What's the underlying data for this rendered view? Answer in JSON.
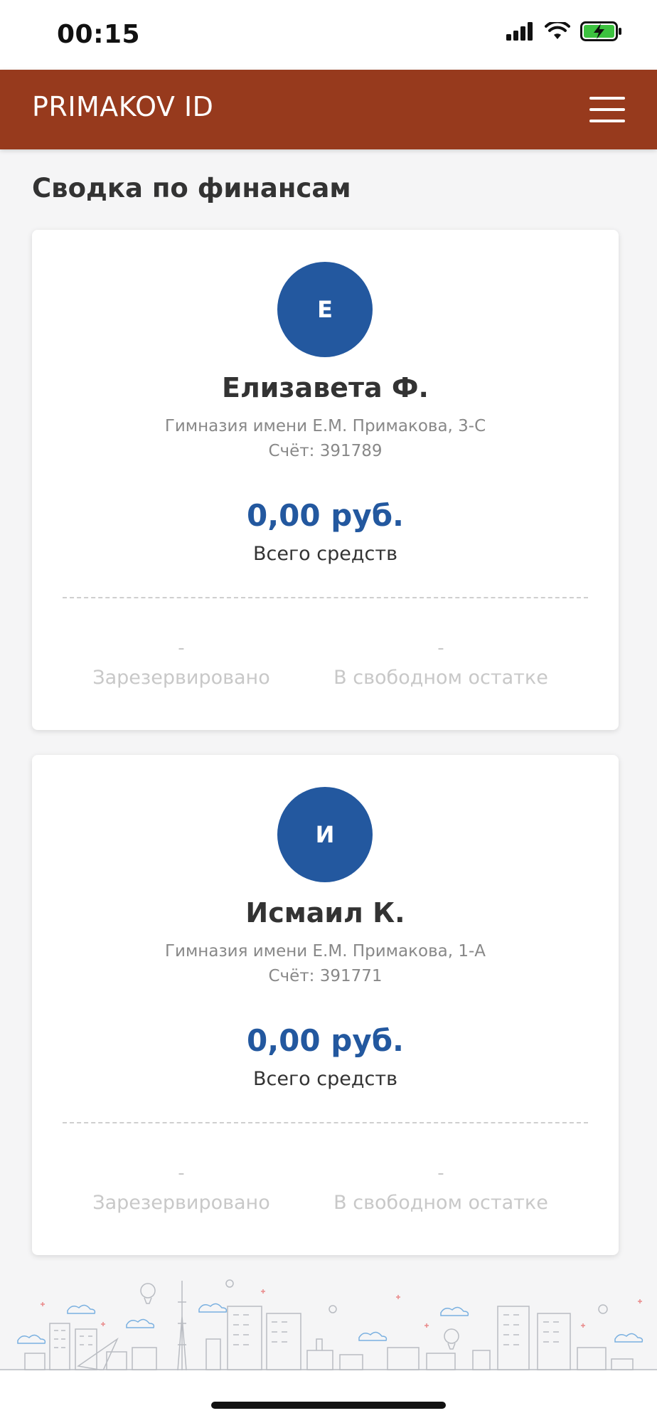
{
  "status": {
    "time": "00:15",
    "icons": [
      "signal-icon",
      "wifi-icon",
      "battery-charging-icon"
    ]
  },
  "header": {
    "title": "PRIMAKOV ID",
    "menu_icon": "hamburger-menu-icon"
  },
  "page": {
    "title": "Сводка по финансам"
  },
  "colors": {
    "header": "#973a1d",
    "accent": "#23589f"
  },
  "students": [
    {
      "initial": "Е",
      "name": "Елизавета Ф.",
      "school": "Гимназия имени Е.М. Примакова, 3-С",
      "account": "Счёт: 391789",
      "balance": "0,00 руб.",
      "balance_label": "Всего средств",
      "reserved_value": "-",
      "reserved_label": "Зарезервировано",
      "free_value": "-",
      "free_label": "В свободном остатке"
    },
    {
      "initial": "И",
      "name": "Исмаил К.",
      "school": "Гимназия имени Е.М. Примакова, 1-А",
      "account": "Счёт: 391771",
      "balance": "0,00 руб.",
      "balance_label": "Всего средств",
      "reserved_value": "-",
      "reserved_label": "Зарезервировано",
      "free_value": "-",
      "free_label": "В свободном остатке"
    }
  ]
}
